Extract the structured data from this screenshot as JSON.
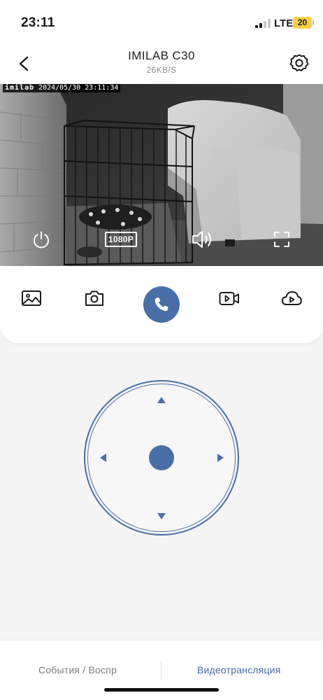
{
  "status": {
    "time": "23:11",
    "network": "LTE",
    "battery": "20",
    "battery_color": "#f7d04a"
  },
  "header": {
    "title": "IMILAB C30",
    "bitrate": "26KB/S",
    "back_icon": "chevron-left-icon",
    "settings_icon": "gear-icon"
  },
  "video": {
    "watermark_logo": "imilab",
    "watermark_time": "2024/05/30  23:11:34",
    "resolution": "1080P",
    "controls": [
      "power-icon",
      "speaker-icon",
      "fullscreen-icon"
    ]
  },
  "actions": {
    "items": [
      "gallery-icon",
      "camera-icon",
      "phone-icon",
      "record-video-icon",
      "cloud-play-icon"
    ],
    "accent_color": "#4a6fa8"
  },
  "ptz": {
    "arrows": [
      "up",
      "down",
      "left",
      "right"
    ]
  },
  "tabs": {
    "items": [
      {
        "label": "События / Воспр",
        "active": false
      },
      {
        "label": "Видеотрансляция",
        "active": true
      }
    ],
    "inactive_color": "#7a7a7e",
    "active_color": "#3f6aa6"
  }
}
